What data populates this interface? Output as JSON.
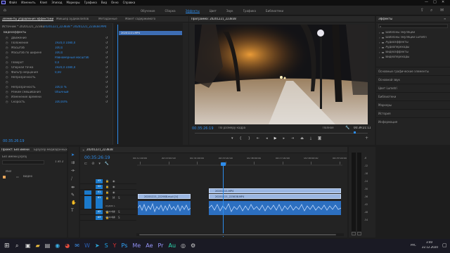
{
  "app_menu": [
    "Файл",
    "Изменить",
    "Клип",
    "Эпизод",
    "Маркеры",
    "Графика",
    "Вид",
    "Окно",
    "Справка"
  ],
  "workspaces": [
    "Обучение",
    "Сборка",
    "Эффекты",
    "Цвет",
    "Звук",
    "Графика",
    "Библиотеки"
  ],
  "active_workspace": 2,
  "effect_controls": {
    "tabs": [
      "Элементы управления эффектами",
      "Микшер аудиоклипов",
      "Метаданные",
      "Макет содержимого"
    ],
    "source_label": "Источник * 20201221_223838.MP4",
    "sequence_label": "20201221_223838 * 20201221_223838.MP4",
    "clip_label": "20201221.MP4",
    "section_video": "Видеоэффекты",
    "rows": [
      {
        "label": "Движение",
        "value": ""
      },
      {
        "label": "Положение",
        "value": "1920,0   1080,0"
      },
      {
        "label": "Масштаб",
        "value": "100,0"
      },
      {
        "label": "Масштаб по ширине",
        "value": "100,0"
      },
      {
        "label": "",
        "value": "Равномерный масштаб"
      },
      {
        "label": "Поворот",
        "value": "0,0"
      },
      {
        "label": "Опорная точка",
        "value": "1920,0   1080,0"
      },
      {
        "label": "Фильтр мерцания",
        "value": "0,00"
      },
      {
        "label": "Непрозрачность",
        "value": ""
      },
      {
        "label": "",
        "value": ""
      },
      {
        "label": "Непрозрачность",
        "value": "100,0 %"
      },
      {
        "label": "Режим смешивания",
        "value": "Обычный"
      },
      {
        "label": "Изменение времени",
        "value": ""
      },
      {
        "label": "Скорость",
        "value": "100,00%"
      }
    ],
    "timecode": "00:35:26:19"
  },
  "program_monitor": {
    "title": "Программа: 20201221_223838",
    "timecode": "00:35:26:19",
    "fit": "По размеру кадра",
    "quality": "Полное",
    "duration": "00:39:21:11"
  },
  "effects_panel": {
    "title": "Эффекты",
    "search_placeholder": "",
    "folders": [
      "Шаблоны эмуляции",
      "Шаблоны эмуляции Lumetri",
      "Аудиоэффекты",
      "Аудиопереходы",
      "Видеоэффекты",
      "Видеопереходы"
    ],
    "sections": [
      "Основные графические элементы",
      "Основной звук",
      "Цвет Lumetri",
      "Библиотеки",
      "Маркеры",
      "История",
      "Информация"
    ]
  },
  "project_panel": {
    "tabs": [
      "Проект: Без имени",
      "Браузер медиаданных"
    ],
    "path": "Без имени.prproj",
    "count": "1 из 2",
    "column": "Имя",
    "items": [
      "Видео"
    ]
  },
  "timeline": {
    "tab": "20201221_223838",
    "timecode": "00:35:26:19",
    "ruler": [
      "00:32:00:00",
      "00:33:00:00",
      "00:34:00:00",
      "00:35:00:00",
      "00:36:00:00",
      "00:37:00:00",
      "00:38:00:00",
      "00:39:00:00"
    ],
    "tracks": {
      "video": [
        "V3",
        "V2",
        "V1"
      ],
      "audio": [
        "A1",
        "A2",
        "A3"
      ]
    },
    "track_names": [
      "Аудио 1",
      "Аудио 2",
      "Аудио 3"
    ],
    "clips": {
      "v2": "20201221.MP4",
      "v1_a": "20201221_222988.mp4 [V]",
      "v1_b": "20201221_223838.MP4"
    }
  },
  "meter_scale": [
    "-6",
    "-12",
    "-18",
    "-24",
    "-30",
    "-36",
    "-42",
    "-48",
    "-54"
  ],
  "taskbar": {
    "time": "3:40",
    "date": "22.12.2020",
    "lang": "РУС"
  },
  "colors": {
    "accent": "#2d8ceb",
    "clip_video": "#9ab6e2",
    "clip_audio": "#3f8ae0",
    "track_blue": "#1b7acb"
  }
}
